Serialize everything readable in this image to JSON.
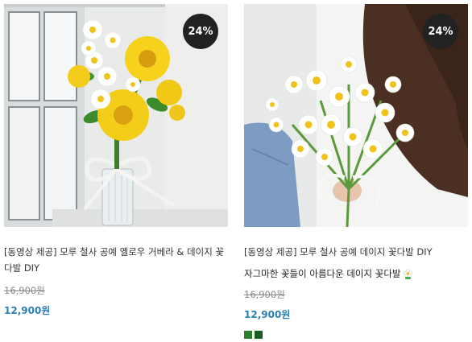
{
  "products": [
    {
      "discount_badge": "24%",
      "title": "[동영상 제공] 모루 철사 공예 옐로우 거베라 & 데이지 꽃다발 DIY",
      "original_price": "16,900원",
      "sale_price": "12,900원"
    },
    {
      "discount_badge": "24%",
      "title": "[동영상 제공] 모루 철사 공예 데이지 꽃다발 DIY",
      "subtitle": "자그마한 꽃들이 아름다운 데이지 꽃다발",
      "subtitle_icon": "flower-emoji-icon",
      "original_price": "16,900원",
      "sale_price": "12,900원",
      "color_swatches": [
        "#2e7d32",
        "#1b5e20"
      ]
    }
  ]
}
